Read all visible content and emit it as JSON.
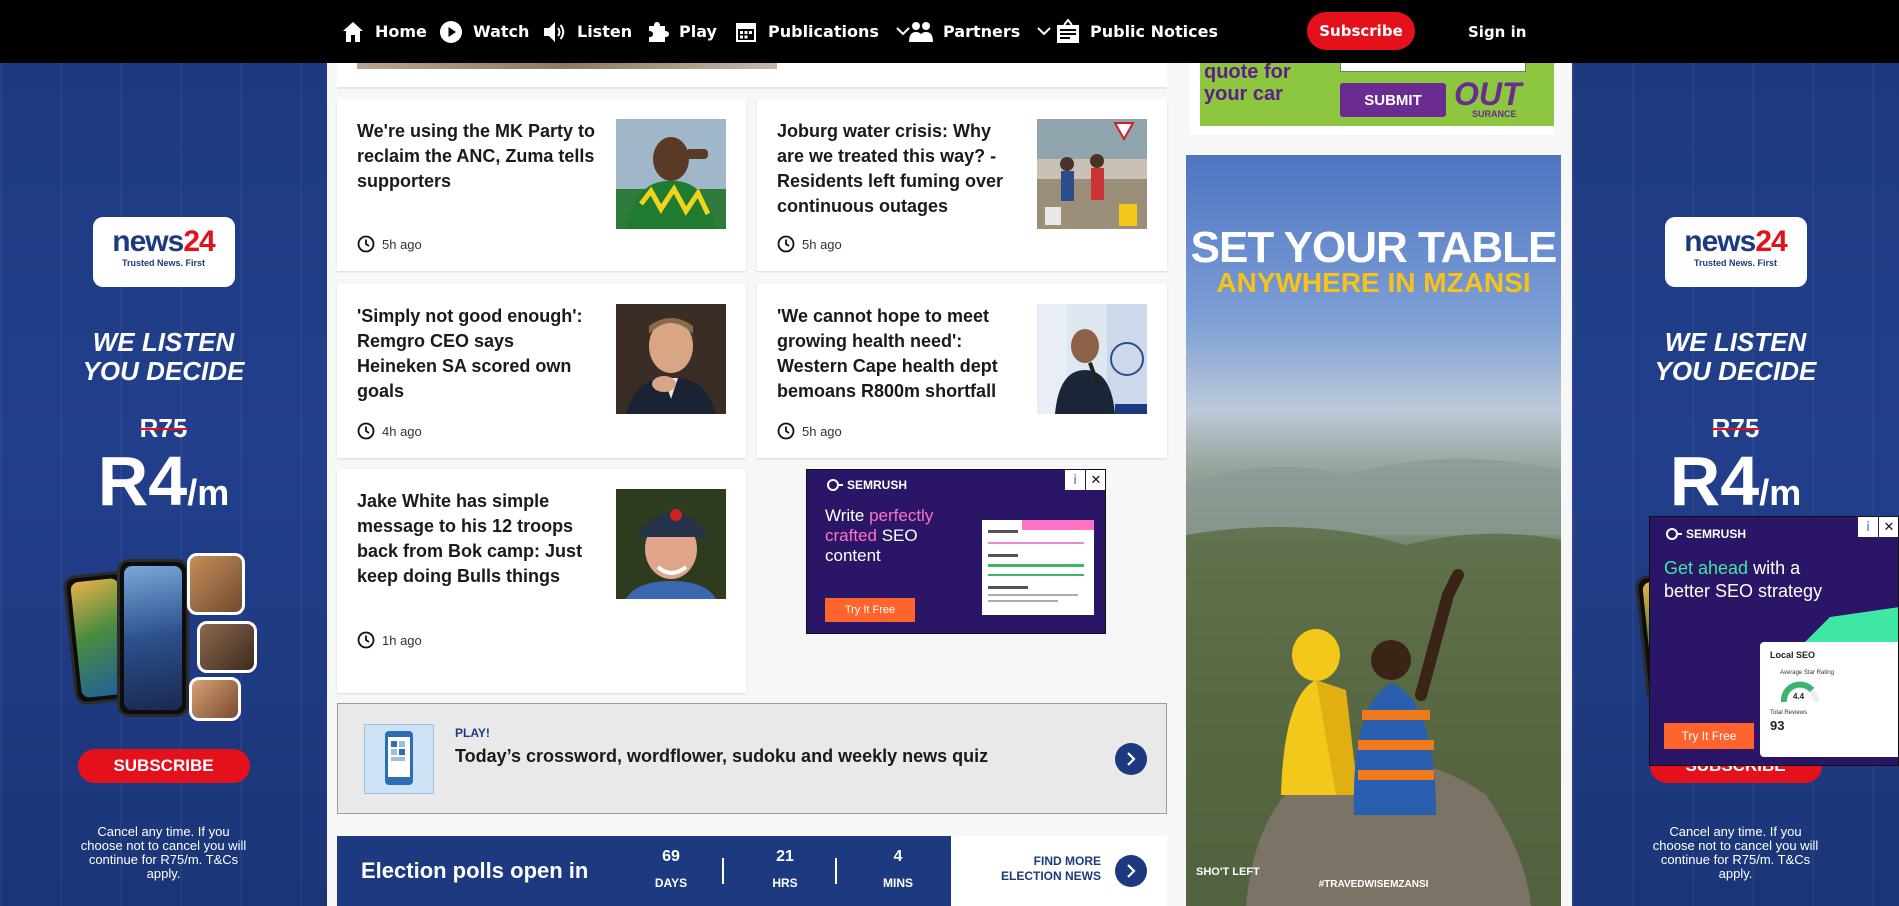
{
  "nav": {
    "home": "Home",
    "watch": "Watch",
    "listen": "Listen",
    "play": "Play",
    "publications": "Publications",
    "partners": "Partners",
    "public_notices": "Public Notices",
    "subscribe": "Subscribe",
    "sign_in": "Sign in"
  },
  "side_ad": {
    "logo_text": "news",
    "logo_num": "24",
    "logo_tag": "Trusted News. First",
    "tagline_1": "WE LISTEN",
    "tagline_2": "YOU DECIDE",
    "old_price": "R75",
    "new_price": "R4",
    "per": "/m",
    "button": "SUBSCRIBE",
    "fine_print": "Cancel any time. If you choose not to cancel you will continue for R75/m. T&Cs apply."
  },
  "articles": [
    {
      "title": "We're using the MK Party to reclaim the ANC, Zuma tells supporters",
      "time": "5h ago"
    },
    {
      "title": "Joburg water crisis: Why are we treated this way? - Residents left fuming over continuous outages",
      "time": "5h ago"
    },
    {
      "title": "'Simply not good enough': Remgro CEO says Heineken SA scored own goals",
      "time": "4h ago"
    },
    {
      "title": "'We cannot hope to meet growing health need': Western Cape health dept bemoans R800m shortfall",
      "time": "5h ago"
    },
    {
      "title": "Jake White has simple message to his 12 troops back from Bok camp: Just keep doing Bulls things",
      "time": "1h ago"
    }
  ],
  "play_banner": {
    "label": "PLAY!",
    "text": "Today’s crossword, wordflower, sudoku and weekly news quiz"
  },
  "election": {
    "title": "Election polls open in",
    "days": "69",
    "days_label": "DAYS",
    "hrs": "21",
    "hrs_label": "HRS",
    "mins": "4",
    "mins_label": "MINS",
    "find_more_1": "FIND MORE",
    "find_more_2": "ELECTION NEWS"
  },
  "semrush_ad": {
    "brand": "SEMRUSH",
    "line_1": "Write ",
    "line_pink": "perfectly crafted",
    "line_2": " SEO content",
    "cta": "Try It Free"
  },
  "semrush_ad_2": {
    "brand": "SEMRUSH",
    "line_green": "Get ahead",
    "line_rest": " with a better SEO strategy",
    "panel_title": "Local SEO",
    "rating_label": "Average Star Rating",
    "rating": "4.4",
    "reviews_label": "Total Reviews",
    "reviews": "93",
    "cta": "Try It Free"
  },
  "outsurance_ad": {
    "headline": "quote for your car",
    "button": "SUBMIT",
    "brand": "OUT",
    "brand_sub": "SURANCE"
  },
  "shotleft_ad": {
    "headline_1": "SET YOUR TABLE",
    "headline_2": "ANYWHERE IN MZANSI",
    "hashtag": "#TRAVEDWISEMZANSI",
    "brand": "SHO'T LEFT"
  },
  "colors": {
    "nav_bg": "#000000",
    "brand_red": "#e4111d",
    "brand_blue": "#1d3a80"
  }
}
